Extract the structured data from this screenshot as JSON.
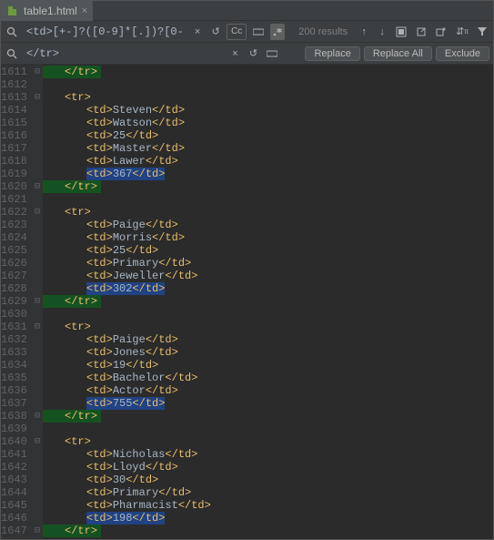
{
  "tab": {
    "filename": "table1.html"
  },
  "searchbar": {
    "find_value": "<td>[+-]?([0-9]*[.])?[0-9]+</td>",
    "replace_value": "</tr>",
    "cc_label": "Cc",
    "results": "200 results"
  },
  "buttons": {
    "replace": "Replace",
    "replace_all": "Replace All",
    "exclude": "Exclude"
  },
  "line_start": 1611,
  "code": {
    "rows": [
      {
        "t": "r1",
        "fn": "Steven",
        "ln": "Watson",
        "age": "25",
        "deg": "Master",
        "job": "Lawer",
        "num": "367"
      },
      {
        "t": "r2",
        "fn": "Paige",
        "ln": "Morris",
        "age": "25",
        "deg": "Primary",
        "job": "Jeweller",
        "num": "302"
      },
      {
        "t": "r3",
        "fn": "Paige",
        "ln": "Jones",
        "age": "19",
        "deg": "Bachelor",
        "job": "Actor",
        "num": "755"
      },
      {
        "t": "r4",
        "fn": "Nicholas",
        "ln": "Lloyd",
        "age": "30",
        "deg": "Primary",
        "job": "Pharmacist",
        "num": "198"
      }
    ],
    "tag_tr_close": "</tr>",
    "tag_tr_open": "<tr>",
    "tag_td_open": "<td>",
    "tag_td_close": "</td>"
  }
}
